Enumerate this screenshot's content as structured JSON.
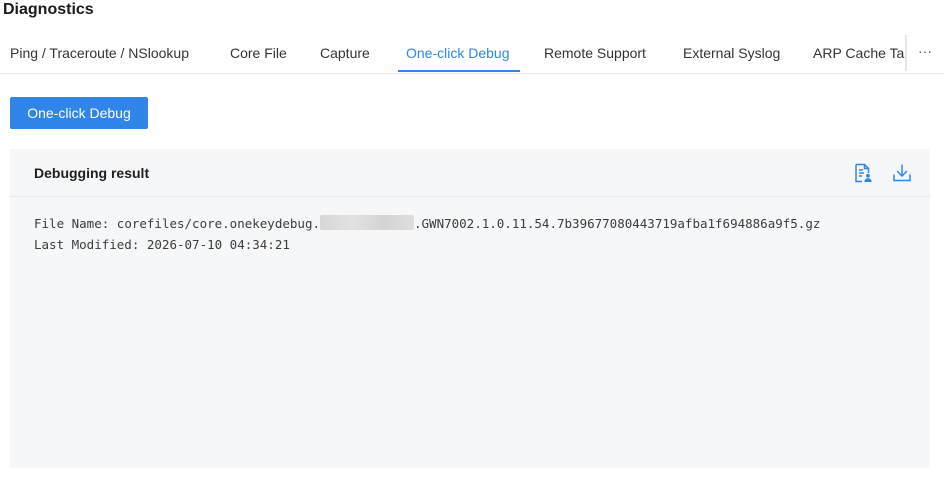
{
  "page": {
    "title": "Diagnostics"
  },
  "tabs": [
    {
      "label": "Ping / Traceroute / NSlookup"
    },
    {
      "label": "Core File"
    },
    {
      "label": "Capture"
    },
    {
      "label": "One-click Debug"
    },
    {
      "label": "Remote Support"
    },
    {
      "label": "External Syslog"
    },
    {
      "label": "ARP Cache Table"
    }
  ],
  "tabs_more": "···",
  "actions": {
    "debug_button": "One-click Debug"
  },
  "result": {
    "title": "Debugging result",
    "file_name_label": "File Name: ",
    "file_name_prefix": "corefiles/core.onekeydebug.",
    "file_name_suffix": ".GWN7002.1.0.11.54.7b39677080443719afba1f694886a9f5.gz",
    "last_modified_label": "Last Modified: ",
    "last_modified_value": "2026-07-10 04:34:21"
  },
  "colors": {
    "accent": "#2f86e8",
    "panel_bg": "#f6f7f8"
  },
  "icons": {
    "report": "document-user-icon",
    "download": "download-icon"
  }
}
